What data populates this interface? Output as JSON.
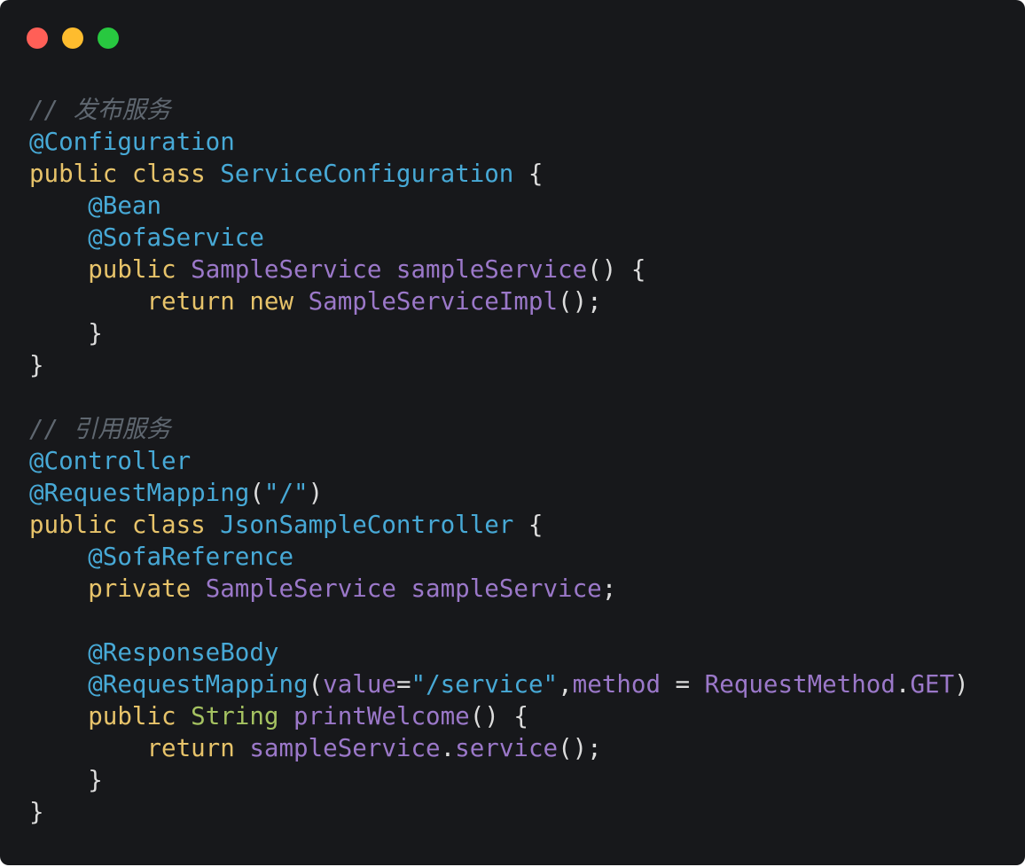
{
  "window": {
    "traffic_lights": [
      {
        "name": "close",
        "color": "#ff5f57"
      },
      {
        "name": "minimize",
        "color": "#febc2e"
      },
      {
        "name": "maximize",
        "color": "#28c840"
      }
    ]
  },
  "colors": {
    "background": "#17181b",
    "comment": "#5f6770",
    "annotation": "#47a9d6",
    "keyword": "#e7c36a",
    "type": "#9b78c9",
    "string": "#a5c261",
    "plain": "#dcdcdc"
  },
  "code": {
    "lines": [
      [
        {
          "t": "comment",
          "v": "// 发布服务"
        }
      ],
      [
        {
          "t": "annotation",
          "v": "@Configuration"
        }
      ],
      [
        {
          "t": "keyword",
          "v": "public class "
        },
        {
          "t": "classname",
          "v": "ServiceConfiguration"
        },
        {
          "t": "plain",
          "v": " {"
        }
      ],
      [
        {
          "t": "plain",
          "v": "    "
        },
        {
          "t": "annotation",
          "v": "@Bean"
        }
      ],
      [
        {
          "t": "plain",
          "v": "    "
        },
        {
          "t": "annotation",
          "v": "@SofaService"
        }
      ],
      [
        {
          "t": "plain",
          "v": "    "
        },
        {
          "t": "keyword",
          "v": "public "
        },
        {
          "t": "type",
          "v": "SampleService sampleService"
        },
        {
          "t": "plain",
          "v": "() {"
        }
      ],
      [
        {
          "t": "plain",
          "v": "        "
        },
        {
          "t": "keyword",
          "v": "return new "
        },
        {
          "t": "type",
          "v": "SampleServiceImpl"
        },
        {
          "t": "plain",
          "v": "();"
        }
      ],
      [
        {
          "t": "plain",
          "v": "    }"
        }
      ],
      [
        {
          "t": "plain",
          "v": "}"
        }
      ],
      [],
      [
        {
          "t": "comment",
          "v": "// 引用服务"
        }
      ],
      [
        {
          "t": "annotation",
          "v": "@Controller"
        }
      ],
      [
        {
          "t": "annotation",
          "v": "@RequestMapping"
        },
        {
          "t": "plain",
          "v": "("
        },
        {
          "t": "annotation",
          "v": "\"/\""
        },
        {
          "t": "plain",
          "v": ")"
        }
      ],
      [
        {
          "t": "keyword",
          "v": "public class "
        },
        {
          "t": "classname",
          "v": "JsonSampleController"
        },
        {
          "t": "plain",
          "v": " {"
        }
      ],
      [
        {
          "t": "plain",
          "v": "    "
        },
        {
          "t": "annotation",
          "v": "@SofaReference"
        }
      ],
      [
        {
          "t": "plain",
          "v": "    "
        },
        {
          "t": "keyword",
          "v": "private "
        },
        {
          "t": "type",
          "v": "SampleService sampleService"
        },
        {
          "t": "plain",
          "v": ";"
        }
      ],
      [],
      [
        {
          "t": "plain",
          "v": "    "
        },
        {
          "t": "annotation",
          "v": "@ResponseBody"
        }
      ],
      [
        {
          "t": "plain",
          "v": "    "
        },
        {
          "t": "annotation",
          "v": "@RequestMapping"
        },
        {
          "t": "plain",
          "v": "("
        },
        {
          "t": "param",
          "v": "value"
        },
        {
          "t": "plain",
          "v": "="
        },
        {
          "t": "annotation",
          "v": "\"/service\""
        },
        {
          "t": "plain",
          "v": ","
        },
        {
          "t": "param",
          "v": "method"
        },
        {
          "t": "plain",
          "v": " = "
        },
        {
          "t": "type",
          "v": "RequestMethod"
        },
        {
          "t": "plain",
          "v": "."
        },
        {
          "t": "param",
          "v": "GET"
        },
        {
          "t": "plain",
          "v": ")"
        }
      ],
      [
        {
          "t": "plain",
          "v": "    "
        },
        {
          "t": "keyword",
          "v": "public "
        },
        {
          "t": "builtin",
          "v": "String "
        },
        {
          "t": "type",
          "v": "printWelcome"
        },
        {
          "t": "plain",
          "v": "() {"
        }
      ],
      [
        {
          "t": "plain",
          "v": "        "
        },
        {
          "t": "keyword",
          "v": "return "
        },
        {
          "t": "type",
          "v": "sampleService"
        },
        {
          "t": "plain",
          "v": "."
        },
        {
          "t": "type",
          "v": "service"
        },
        {
          "t": "plain",
          "v": "();"
        }
      ],
      [
        {
          "t": "plain",
          "v": "    }"
        }
      ],
      [
        {
          "t": "plain",
          "v": "}"
        }
      ]
    ]
  }
}
